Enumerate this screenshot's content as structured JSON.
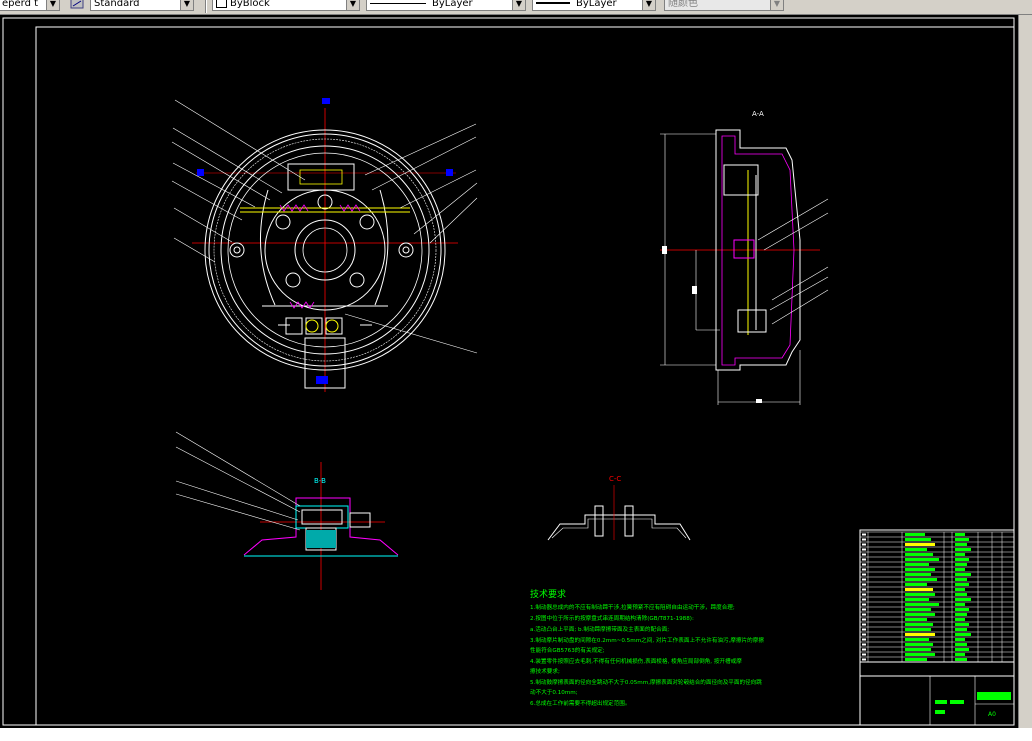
{
  "toolbar": {
    "text_style_partial": "eperd t",
    "dim_style": "Standard",
    "color": "ByBlock",
    "linetype": "ByLayer",
    "lineweight": "ByLayer",
    "plot_style": "随颜色"
  },
  "drawing": {
    "section_aa_label": "A-A",
    "section_bb_label": "B-B",
    "section_cc_label": "C-C",
    "tech_title": "技术要求",
    "tech_lines": [
      "1.制动器总成内的不应有制动蹄干涉,拉簧预紧不应有阻碍自由运动干涉，蹄度合理;",
      "2.按图中位于所示的按摩盘式串连周期结构清除(GB/T871-1988):",
      "  a.活动凸台上平面; b.制动蹄摩擦带面及主表面的配合面;",
      "3.制动摩片制动盘的间隙在0.2mm~0.5mm之间, 对片工作表面上不允许有油污,摩擦片的摩擦",
      "  性能符合GB5763的有关规定;",
      "4.装置零件按照应去毛刺,不得有任何机械损伤,表面棱格, 棱角应局部倒角, 按开槽或摩",
      "  擦技术要求;",
      "5.制动鼓摩擦表面的径向全跳动不大于0.05mm,摩擦表面对轮毂结合的面径向及平面的径向跳",
      "  动不大于0.10mm;",
      "6.总成在工作前需要不得超出规定范围。"
    ],
    "sheet_number": "A0"
  }
}
